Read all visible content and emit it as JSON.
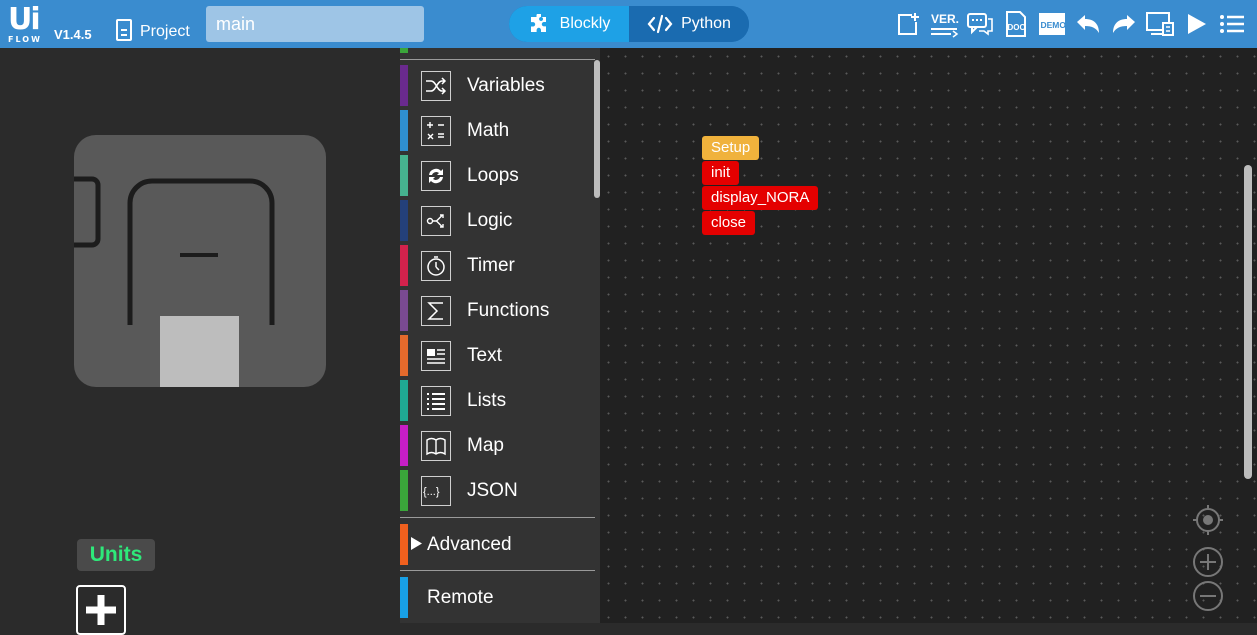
{
  "app": {
    "logo_text": "Ui",
    "logo_sub": "FLOW",
    "version": "V1.4.5",
    "project_label": "Project",
    "file_name": "main"
  },
  "editor_toggle": {
    "blockly_label": "Blockly",
    "python_label": "Python",
    "active": "Blockly"
  },
  "toolbar_icons": [
    "new-file-icon",
    "version-icon",
    "comments-icon",
    "doc-icon",
    "demo-icon",
    "undo-icon",
    "redo-icon",
    "device-screen-icon",
    "run-icon",
    "menu-icon"
  ],
  "toolbar_icon_text": {
    "version": "VER.",
    "doc": "DOC",
    "demo": "DEMO"
  },
  "units": {
    "label": "Units"
  },
  "toolbox": {
    "categories": [
      {
        "label": "Variables",
        "color": "#6a2a8e",
        "icon": "shuffle-icon"
      },
      {
        "label": "Math",
        "color": "#2f8fd0",
        "icon": "math-icon"
      },
      {
        "label": "Loops",
        "color": "#46b38f",
        "icon": "loop-icon"
      },
      {
        "label": "Logic",
        "color": "#24407a",
        "icon": "logic-icon"
      },
      {
        "label": "Timer",
        "color": "#d3224c",
        "icon": "timer-icon"
      },
      {
        "label": "Functions",
        "color": "#7a4a92",
        "icon": "sigma-icon"
      },
      {
        "label": "Text",
        "color": "#e46a2c",
        "icon": "text-icon"
      },
      {
        "label": "Lists",
        "color": "#1fa893",
        "icon": "list-icon"
      },
      {
        "label": "Map",
        "color": "#c61ec6",
        "icon": "map-icon"
      },
      {
        "label": "JSON",
        "color": "#3aa53a",
        "icon": "json-icon"
      }
    ],
    "json_icon_text": "{...}",
    "math_icon_text": "+ =\n× ÷",
    "advanced_label": "Advanced",
    "remote_label": "Remote",
    "advanced_color": "#f0601e",
    "remote_color": "#18a0e6"
  },
  "blocks": {
    "setup": "Setup",
    "init": "init",
    "display": "display_NORA",
    "close": "close"
  }
}
